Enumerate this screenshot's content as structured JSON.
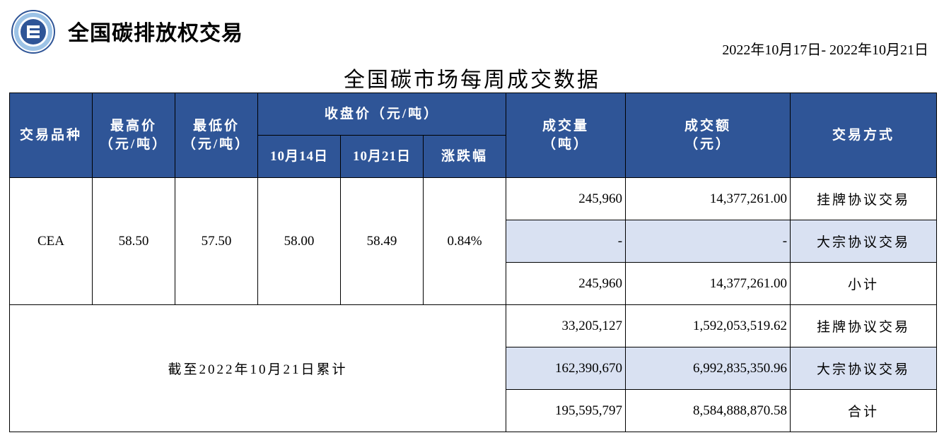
{
  "header": {
    "brand": "全国碳排放权交易",
    "date_range": "2022年10月17日- 2022年10月21日",
    "title": "全国碳市场每周成交数据"
  },
  "table": {
    "headers": {
      "variety": "交易品种",
      "high": [
        "最高价",
        "（元/吨）"
      ],
      "low": [
        "最低价",
        "（元/吨）"
      ],
      "close": "收盘价（元/吨）",
      "close_d1": "10月14日",
      "close_d2": "10月21日",
      "change": "涨跌幅",
      "volume": [
        "成交量",
        "（吨）"
      ],
      "amount": [
        "成交额",
        "（元）"
      ],
      "method": "交易方式"
    },
    "weekly": {
      "variety": "CEA",
      "high": "58.50",
      "low": "57.50",
      "close_d1": "58.00",
      "close_d2": "58.49",
      "change": "0.84%",
      "rows": [
        {
          "volume": "245,960",
          "amount": "14,377,261.00",
          "method": "挂牌协议交易"
        },
        {
          "volume": "-",
          "amount": "-",
          "method": "大宗协议交易"
        },
        {
          "volume": "245,960",
          "amount": "14,377,261.00",
          "method": "小计"
        }
      ]
    },
    "cumulative": {
      "label": "截至2022年10月21日累计",
      "rows": [
        {
          "volume": "33,205,127",
          "amount": "1,592,053,519.62",
          "method": "挂牌协议交易"
        },
        {
          "volume": "162,390,670",
          "amount": "6,992,835,350.96",
          "method": "大宗协议交易"
        },
        {
          "volume": "195,595,797",
          "amount": "8,584,888,870.58",
          "method": "合计"
        }
      ]
    }
  },
  "colors": {
    "header_bg": "#2f5597",
    "alt_row_bg": "#d9e1f2"
  }
}
